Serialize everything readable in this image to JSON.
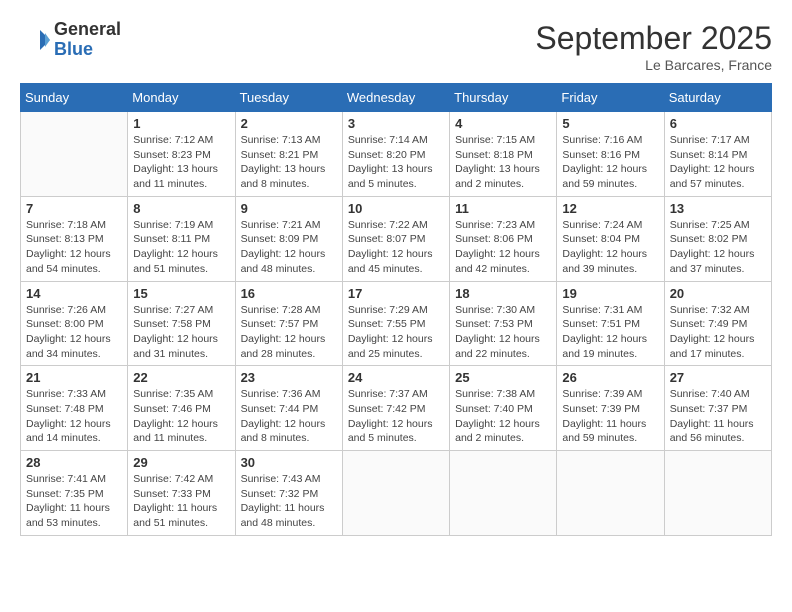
{
  "logo": {
    "general": "General",
    "blue": "Blue"
  },
  "title": "September 2025",
  "subtitle": "Le Barcares, France",
  "days_of_week": [
    "Sunday",
    "Monday",
    "Tuesday",
    "Wednesday",
    "Thursday",
    "Friday",
    "Saturday"
  ],
  "weeks": [
    [
      {
        "day": "",
        "info": ""
      },
      {
        "day": "1",
        "info": "Sunrise: 7:12 AM\nSunset: 8:23 PM\nDaylight: 13 hours\nand 11 minutes."
      },
      {
        "day": "2",
        "info": "Sunrise: 7:13 AM\nSunset: 8:21 PM\nDaylight: 13 hours\nand 8 minutes."
      },
      {
        "day": "3",
        "info": "Sunrise: 7:14 AM\nSunset: 8:20 PM\nDaylight: 13 hours\nand 5 minutes."
      },
      {
        "day": "4",
        "info": "Sunrise: 7:15 AM\nSunset: 8:18 PM\nDaylight: 13 hours\nand 2 minutes."
      },
      {
        "day": "5",
        "info": "Sunrise: 7:16 AM\nSunset: 8:16 PM\nDaylight: 12 hours\nand 59 minutes."
      },
      {
        "day": "6",
        "info": "Sunrise: 7:17 AM\nSunset: 8:14 PM\nDaylight: 12 hours\nand 57 minutes."
      }
    ],
    [
      {
        "day": "7",
        "info": "Sunrise: 7:18 AM\nSunset: 8:13 PM\nDaylight: 12 hours\nand 54 minutes."
      },
      {
        "day": "8",
        "info": "Sunrise: 7:19 AM\nSunset: 8:11 PM\nDaylight: 12 hours\nand 51 minutes."
      },
      {
        "day": "9",
        "info": "Sunrise: 7:21 AM\nSunset: 8:09 PM\nDaylight: 12 hours\nand 48 minutes."
      },
      {
        "day": "10",
        "info": "Sunrise: 7:22 AM\nSunset: 8:07 PM\nDaylight: 12 hours\nand 45 minutes."
      },
      {
        "day": "11",
        "info": "Sunrise: 7:23 AM\nSunset: 8:06 PM\nDaylight: 12 hours\nand 42 minutes."
      },
      {
        "day": "12",
        "info": "Sunrise: 7:24 AM\nSunset: 8:04 PM\nDaylight: 12 hours\nand 39 minutes."
      },
      {
        "day": "13",
        "info": "Sunrise: 7:25 AM\nSunset: 8:02 PM\nDaylight: 12 hours\nand 37 minutes."
      }
    ],
    [
      {
        "day": "14",
        "info": "Sunrise: 7:26 AM\nSunset: 8:00 PM\nDaylight: 12 hours\nand 34 minutes."
      },
      {
        "day": "15",
        "info": "Sunrise: 7:27 AM\nSunset: 7:58 PM\nDaylight: 12 hours\nand 31 minutes."
      },
      {
        "day": "16",
        "info": "Sunrise: 7:28 AM\nSunset: 7:57 PM\nDaylight: 12 hours\nand 28 minutes."
      },
      {
        "day": "17",
        "info": "Sunrise: 7:29 AM\nSunset: 7:55 PM\nDaylight: 12 hours\nand 25 minutes."
      },
      {
        "day": "18",
        "info": "Sunrise: 7:30 AM\nSunset: 7:53 PM\nDaylight: 12 hours\nand 22 minutes."
      },
      {
        "day": "19",
        "info": "Sunrise: 7:31 AM\nSunset: 7:51 PM\nDaylight: 12 hours\nand 19 minutes."
      },
      {
        "day": "20",
        "info": "Sunrise: 7:32 AM\nSunset: 7:49 PM\nDaylight: 12 hours\nand 17 minutes."
      }
    ],
    [
      {
        "day": "21",
        "info": "Sunrise: 7:33 AM\nSunset: 7:48 PM\nDaylight: 12 hours\nand 14 minutes."
      },
      {
        "day": "22",
        "info": "Sunrise: 7:35 AM\nSunset: 7:46 PM\nDaylight: 12 hours\nand 11 minutes."
      },
      {
        "day": "23",
        "info": "Sunrise: 7:36 AM\nSunset: 7:44 PM\nDaylight: 12 hours\nand 8 minutes."
      },
      {
        "day": "24",
        "info": "Sunrise: 7:37 AM\nSunset: 7:42 PM\nDaylight: 12 hours\nand 5 minutes."
      },
      {
        "day": "25",
        "info": "Sunrise: 7:38 AM\nSunset: 7:40 PM\nDaylight: 12 hours\nand 2 minutes."
      },
      {
        "day": "26",
        "info": "Sunrise: 7:39 AM\nSunset: 7:39 PM\nDaylight: 11 hours\nand 59 minutes."
      },
      {
        "day": "27",
        "info": "Sunrise: 7:40 AM\nSunset: 7:37 PM\nDaylight: 11 hours\nand 56 minutes."
      }
    ],
    [
      {
        "day": "28",
        "info": "Sunrise: 7:41 AM\nSunset: 7:35 PM\nDaylight: 11 hours\nand 53 minutes."
      },
      {
        "day": "29",
        "info": "Sunrise: 7:42 AM\nSunset: 7:33 PM\nDaylight: 11 hours\nand 51 minutes."
      },
      {
        "day": "30",
        "info": "Sunrise: 7:43 AM\nSunset: 7:32 PM\nDaylight: 11 hours\nand 48 minutes."
      },
      {
        "day": "",
        "info": ""
      },
      {
        "day": "",
        "info": ""
      },
      {
        "day": "",
        "info": ""
      },
      {
        "day": "",
        "info": ""
      }
    ]
  ]
}
